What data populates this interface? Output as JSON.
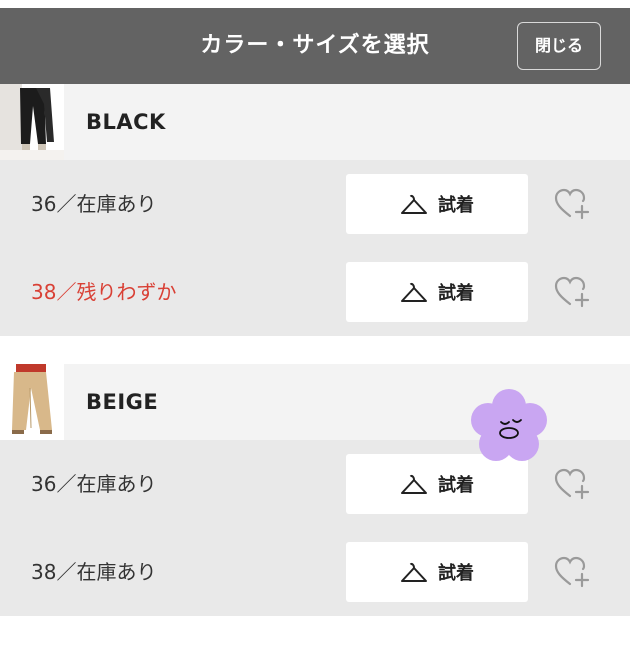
{
  "header": {
    "title": "カラー・サイズを選択",
    "close_label": "閉じる"
  },
  "colors": [
    {
      "name": "BLACK",
      "sizes": [
        {
          "label": "36／在庫あり",
          "stock": "in-stock",
          "tryon_label": "試着"
        },
        {
          "label": "38／残りわずか",
          "stock": "low",
          "tryon_label": "試着"
        }
      ]
    },
    {
      "name": "BEIGE",
      "sizes": [
        {
          "label": "36／在庫あり",
          "stock": "in-stock",
          "tryon_label": "試着"
        },
        {
          "label": "38／在庫あり",
          "stock": "in-stock",
          "tryon_label": "試着"
        }
      ]
    }
  ],
  "icons": {
    "tryon": "hanger-icon",
    "favorite": "heart-plus-icon",
    "sticker": "flower-sticker"
  },
  "theme": {
    "header_bg": "#636363",
    "low_stock": "#d94035",
    "sticker": "#c9a6f2"
  }
}
